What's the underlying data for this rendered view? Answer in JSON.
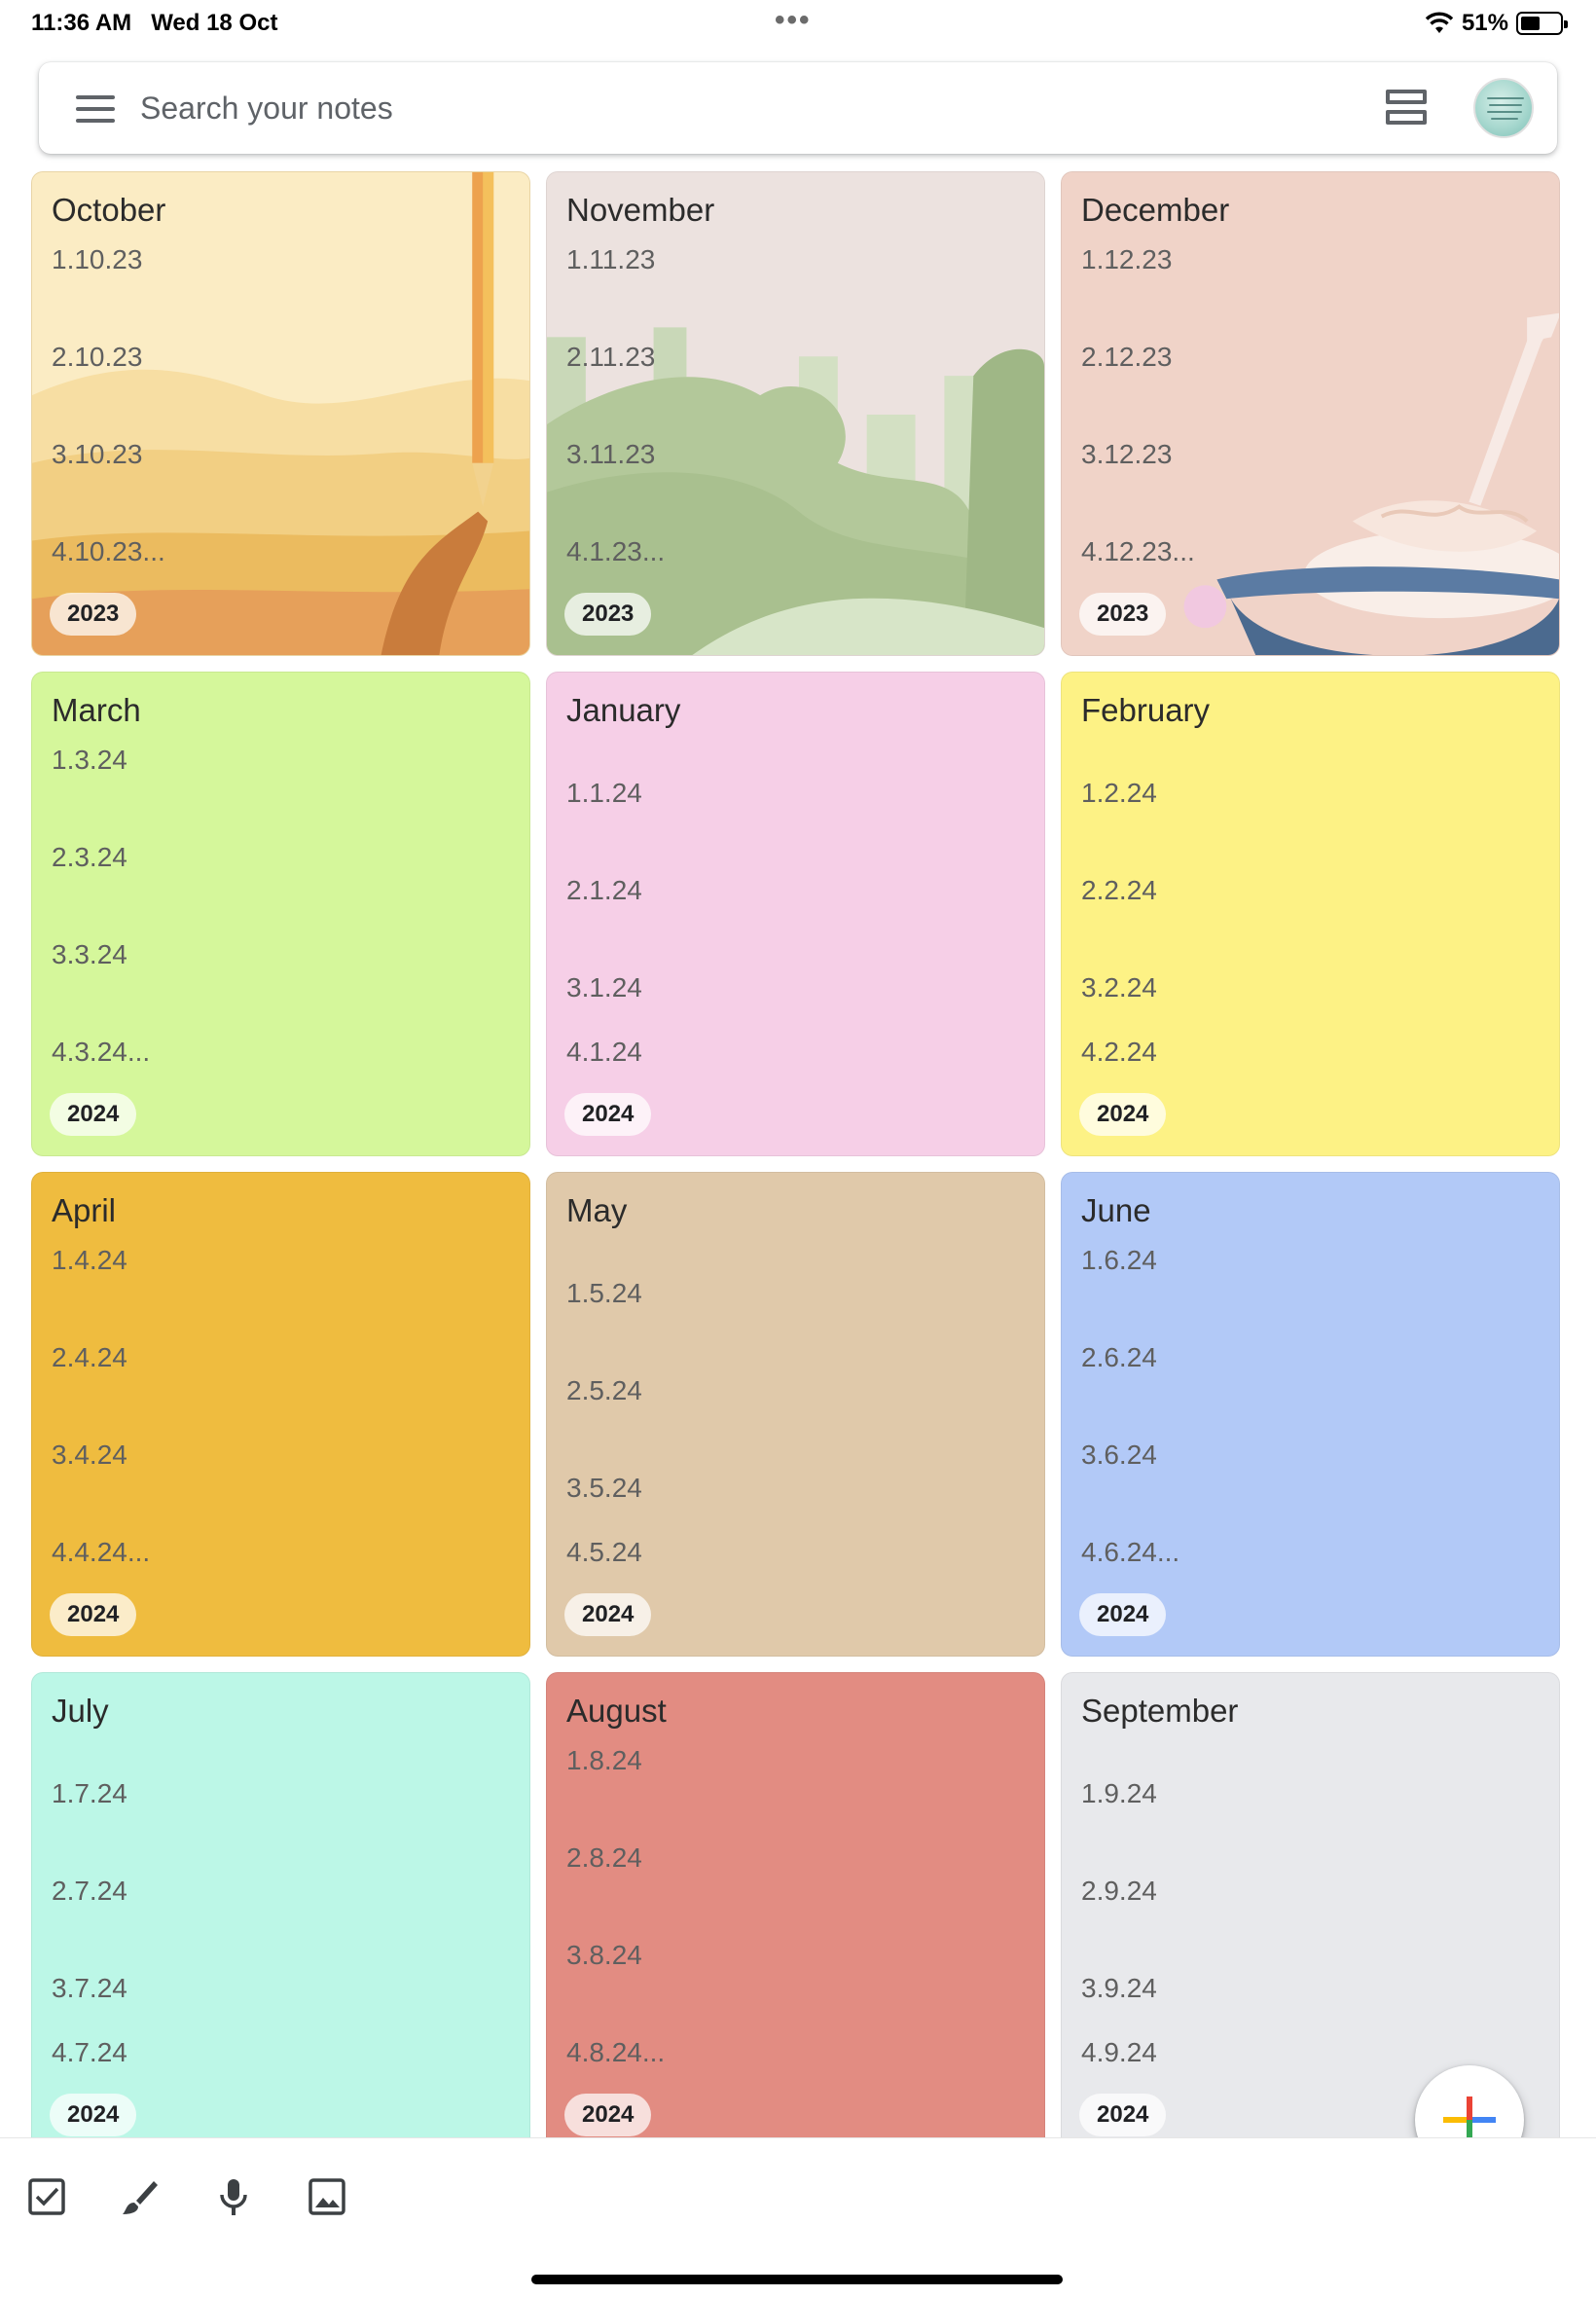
{
  "status_bar": {
    "time": "11:36 AM",
    "date": "Wed 18 Oct",
    "dots": "•••",
    "battery_percent": "51%",
    "battery_level": 0.51
  },
  "search": {
    "placeholder": "Search your notes",
    "menu_icon": "hamburger-menu-icon",
    "view_icon": "list-view-icon"
  },
  "notes": [
    {
      "title": "October",
      "lines": [
        "1.10.23",
        "2.10.23",
        "3.10.23",
        "4.10.23..."
      ],
      "label": "2023",
      "bg": "#f7e2b0"
    },
    {
      "title": "November",
      "lines": [
        "1.11.23",
        "2.11.23",
        "3.11.23",
        "4.1.23..."
      ],
      "label": "2023",
      "bg": "#ece2df"
    },
    {
      "title": "December",
      "lines": [
        "1.12.23",
        "2.12.23",
        "3.12.23",
        "4.12.23..."
      ],
      "label": "2023",
      "bg": "#f0d3c8"
    },
    {
      "title": "March",
      "lines": [
        "1.3.24",
        "2.3.24",
        "3.3.24",
        "4.3.24..."
      ],
      "label": "2024",
      "bg": "#d5f79b"
    },
    {
      "title": "January",
      "lines": [
        "1.1.24",
        "2.1.24",
        "3.1.24",
        "4.1.24"
      ],
      "label": "2024",
      "bg": "#f6cfe7"
    },
    {
      "title": "February",
      "lines": [
        "1.2.24",
        "2.2.24",
        "3.2.24",
        "4.2.24"
      ],
      "label": "2024",
      "bg": "#fdf285"
    },
    {
      "title": "April",
      "lines": [
        "1.4.24",
        "2.4.24",
        "3.4.24",
        "4.4.24..."
      ],
      "label": "2024",
      "bg": "#efbc3f"
    },
    {
      "title": "May",
      "lines": [
        "1.5.24",
        "2.5.24",
        "3.5.24",
        "4.5.24"
      ],
      "label": "2024",
      "bg": "#e0c9aa"
    },
    {
      "title": "June",
      "lines": [
        "1.6.24",
        "2.6.24",
        "3.6.24",
        "4.6.24..."
      ],
      "label": "2024",
      "bg": "#b2c9f7"
    },
    {
      "title": "July",
      "lines": [
        "1.7.24",
        "2.7.24",
        "3.7.24",
        "4.7.24"
      ],
      "label": "2024",
      "bg": "#bcf7e7"
    },
    {
      "title": "August",
      "lines": [
        "1.8.24",
        "2.8.24",
        "3.8.24",
        "4.8.24..."
      ],
      "label": "2024",
      "bg": "#e28c82"
    },
    {
      "title": "September",
      "lines": [
        "1.9.24",
        "2.9.24",
        "3.9.24",
        "4.9.24"
      ],
      "label": "2024",
      "bg": "#e8e9ec"
    }
  ],
  "bottom_bar": {
    "icons": [
      "checkbox-icon",
      "brush-icon",
      "microphone-icon",
      "image-icon"
    ]
  },
  "fab": {
    "icon": "plus-icon",
    "colors": [
      "#ea4335",
      "#fbbc04",
      "#34a853",
      "#4285f4"
    ]
  }
}
